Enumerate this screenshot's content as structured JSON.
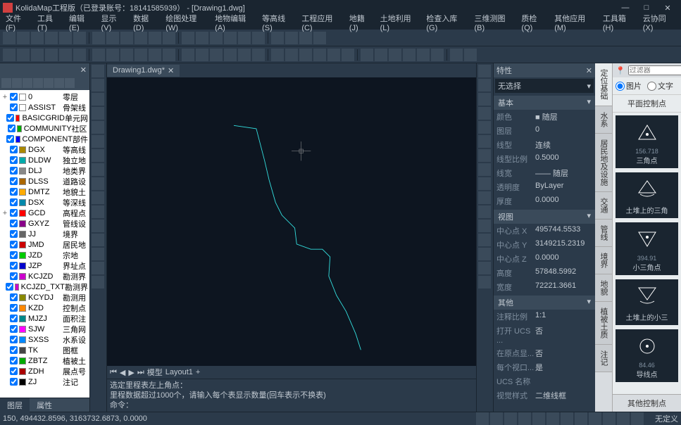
{
  "title": "KolidaMap工程版（已登录账号：18141585939）  - [Drawing1.dwg]",
  "menus": [
    "文件(F)",
    "工具(T)",
    "编辑(E)",
    "显示(V)",
    "数据(D)",
    "绘图处理(W)",
    "地物编辑(A)",
    "等高线(S)",
    "工程应用(C)",
    "地籍(J)",
    "土地利用(L)",
    "检查入库(G)",
    "三维测图(B)",
    "质检(Q)",
    "其他应用(M)",
    "工具箱(H)",
    "云协同(X)"
  ],
  "doc_tab": "Drawing1.dwg*",
  "layers": [
    {
      "exp": "+",
      "name": "0",
      "desc": "零层",
      "color": "#fff"
    },
    {
      "name": "ASSIST",
      "desc": "骨架线",
      "color": "#fff"
    },
    {
      "name": "BASICGRID",
      "desc": "单元网",
      "color": "#f00"
    },
    {
      "name": "COMMUNITY",
      "desc": "社区",
      "color": "#0a0"
    },
    {
      "name": "COMPONENT",
      "desc": "部件",
      "color": "#00f"
    },
    {
      "name": "DGX",
      "desc": "等高线",
      "color": "#a80"
    },
    {
      "name": "DLDW",
      "desc": "独立地",
      "color": "#0aa"
    },
    {
      "name": "DLJ",
      "desc": "地类界",
      "color": "#888"
    },
    {
      "name": "DLSS",
      "desc": "道路设",
      "color": "#a60"
    },
    {
      "name": "DMTZ",
      "desc": "地貌土",
      "color": "#fa0"
    },
    {
      "name": "DSX",
      "desc": "等深线",
      "color": "#08a"
    },
    {
      "exp": "+",
      "name": "GCD",
      "desc": "高程点",
      "color": "#f00"
    },
    {
      "name": "GXYZ",
      "desc": "管线设",
      "color": "#808"
    },
    {
      "name": "JJ",
      "desc": "境界",
      "color": "#666"
    },
    {
      "name": "JMD",
      "desc": "居民地",
      "color": "#c00"
    },
    {
      "name": "JZD",
      "desc": "宗地",
      "color": "#0c0"
    },
    {
      "name": "JZP",
      "desc": "界址点",
      "color": "#00c"
    },
    {
      "name": "KCJZD",
      "desc": "勘测界",
      "color": "#c0c"
    },
    {
      "name": "KCJZD_TXT",
      "desc": "勘测界",
      "color": "#c0c"
    },
    {
      "name": "KCYDJ",
      "desc": "勘测用",
      "color": "#880"
    },
    {
      "name": "KZD",
      "desc": "控制点",
      "color": "#f80"
    },
    {
      "name": "MJZJ",
      "desc": "面积注",
      "color": "#088"
    },
    {
      "name": "SJW",
      "desc": "三角网",
      "color": "#f0f"
    },
    {
      "name": "SXSS",
      "desc": "水系设",
      "color": "#08f"
    },
    {
      "name": "TK",
      "desc": "图框",
      "color": "#444"
    },
    {
      "name": "ZBTZ",
      "desc": "植被土",
      "color": "#0a0"
    },
    {
      "name": "ZDH",
      "desc": "展点号",
      "color": "#a00"
    },
    {
      "name": "ZJ",
      "desc": "注记",
      "color": "#000"
    }
  ],
  "bottom_tabs": {
    "tab1": "图层",
    "tab2": "属性"
  },
  "canvas_tabs": {
    "model": "模型",
    "layout": "Layout1"
  },
  "prop": {
    "title": "特性",
    "select": "无选择",
    "groups": {
      "basic": {
        "title": "基本",
        "rows": [
          {
            "k": "颜色",
            "v": "■ 随层"
          },
          {
            "k": "图层",
            "v": "0"
          },
          {
            "k": "线型",
            "v": "连续"
          },
          {
            "k": "线型比例",
            "v": "0.5000"
          },
          {
            "k": "线宽",
            "v": "—— 随层"
          },
          {
            "k": "透明度",
            "v": "ByLayer"
          },
          {
            "k": "厚度",
            "v": "0.0000"
          }
        ]
      },
      "view": {
        "title": "视图",
        "rows": [
          {
            "k": "中心点 X",
            "v": "495744.5533"
          },
          {
            "k": "中心点 Y",
            "v": "3149215.2319"
          },
          {
            "k": "中心点 Z",
            "v": "0.0000"
          },
          {
            "k": "高度",
            "v": "57848.5992"
          },
          {
            "k": "宽度",
            "v": "72221.3661"
          }
        ]
      },
      "other": {
        "title": "其他",
        "rows": [
          {
            "k": "注释比例",
            "v": "1:1"
          },
          {
            "k": "打开 UCS ...",
            "v": "否"
          },
          {
            "k": "在原点显...",
            "v": "否"
          },
          {
            "k": "每个视口...",
            "v": "是"
          },
          {
            "k": "UCS 名称",
            "v": ""
          },
          {
            "k": "视觉样式",
            "v": "二维线框"
          }
        ]
      }
    }
  },
  "sidetabs": [
    "定位基础",
    "水系",
    "居民地及设施",
    "交通",
    "管线",
    "境界",
    "地貌",
    "植被土质",
    "注记"
  ],
  "symbol": {
    "filter": "过滤器",
    "radio1": "图片",
    "radio2": "文字",
    "title": "平面控制点",
    "items": [
      {
        "label": "三角点",
        "sub": "156.718",
        "svg": "tri"
      },
      {
        "label": "土堆上的三角",
        "sub": "",
        "svg": "tri2"
      },
      {
        "label": "小三角点",
        "sub": "394.91",
        "svg": "triinv"
      },
      {
        "label": "土堆上的小三",
        "sub": "",
        "svg": "triinv2"
      },
      {
        "label": "导线点",
        "sub": "84.46",
        "svg": "circ"
      }
    ],
    "footer": "其他控制点"
  },
  "cmd": {
    "line1": "选定里程表左上角点：",
    "line2": "里程数据超过1000个，请输入每个表显示数量(回车表示不换表)",
    "prompt": "命令："
  },
  "status": {
    "coords": "150, 494432.8596, 3163732.6873, 0.0000",
    "snap": "无定义"
  }
}
